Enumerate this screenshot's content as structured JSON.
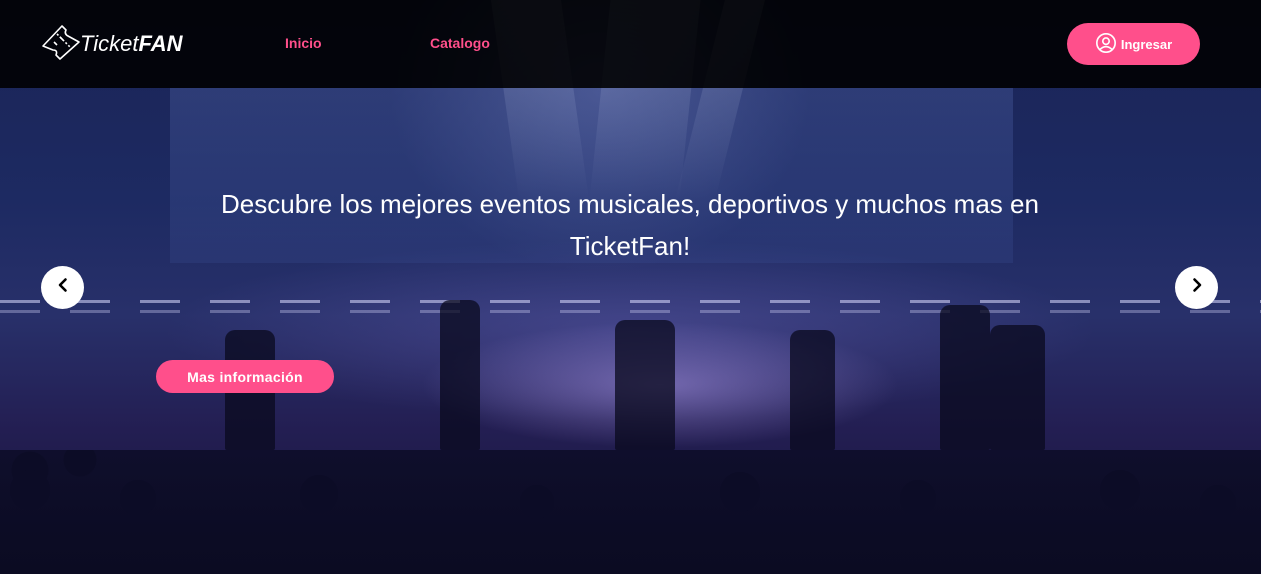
{
  "brand": {
    "name_part1": "Ticket",
    "name_part2": "FAN",
    "logo_icon": "ticket-icon"
  },
  "nav": {
    "links": [
      {
        "label": "Inicio"
      },
      {
        "label": "Catalogo"
      }
    ]
  },
  "login": {
    "label": "Ingresar",
    "icon": "user-circle-icon"
  },
  "hero": {
    "headline": "Descubre los mejores eventos musicales, deportivos y muchos mas en TicketFan!",
    "cta_label": "Mas información",
    "prev_icon": "chevron-left-icon",
    "next_icon": "chevron-right-icon"
  },
  "colors": {
    "accent": "#ff4f8b",
    "navbar_bg": "#000000",
    "text": "#ffffff"
  }
}
